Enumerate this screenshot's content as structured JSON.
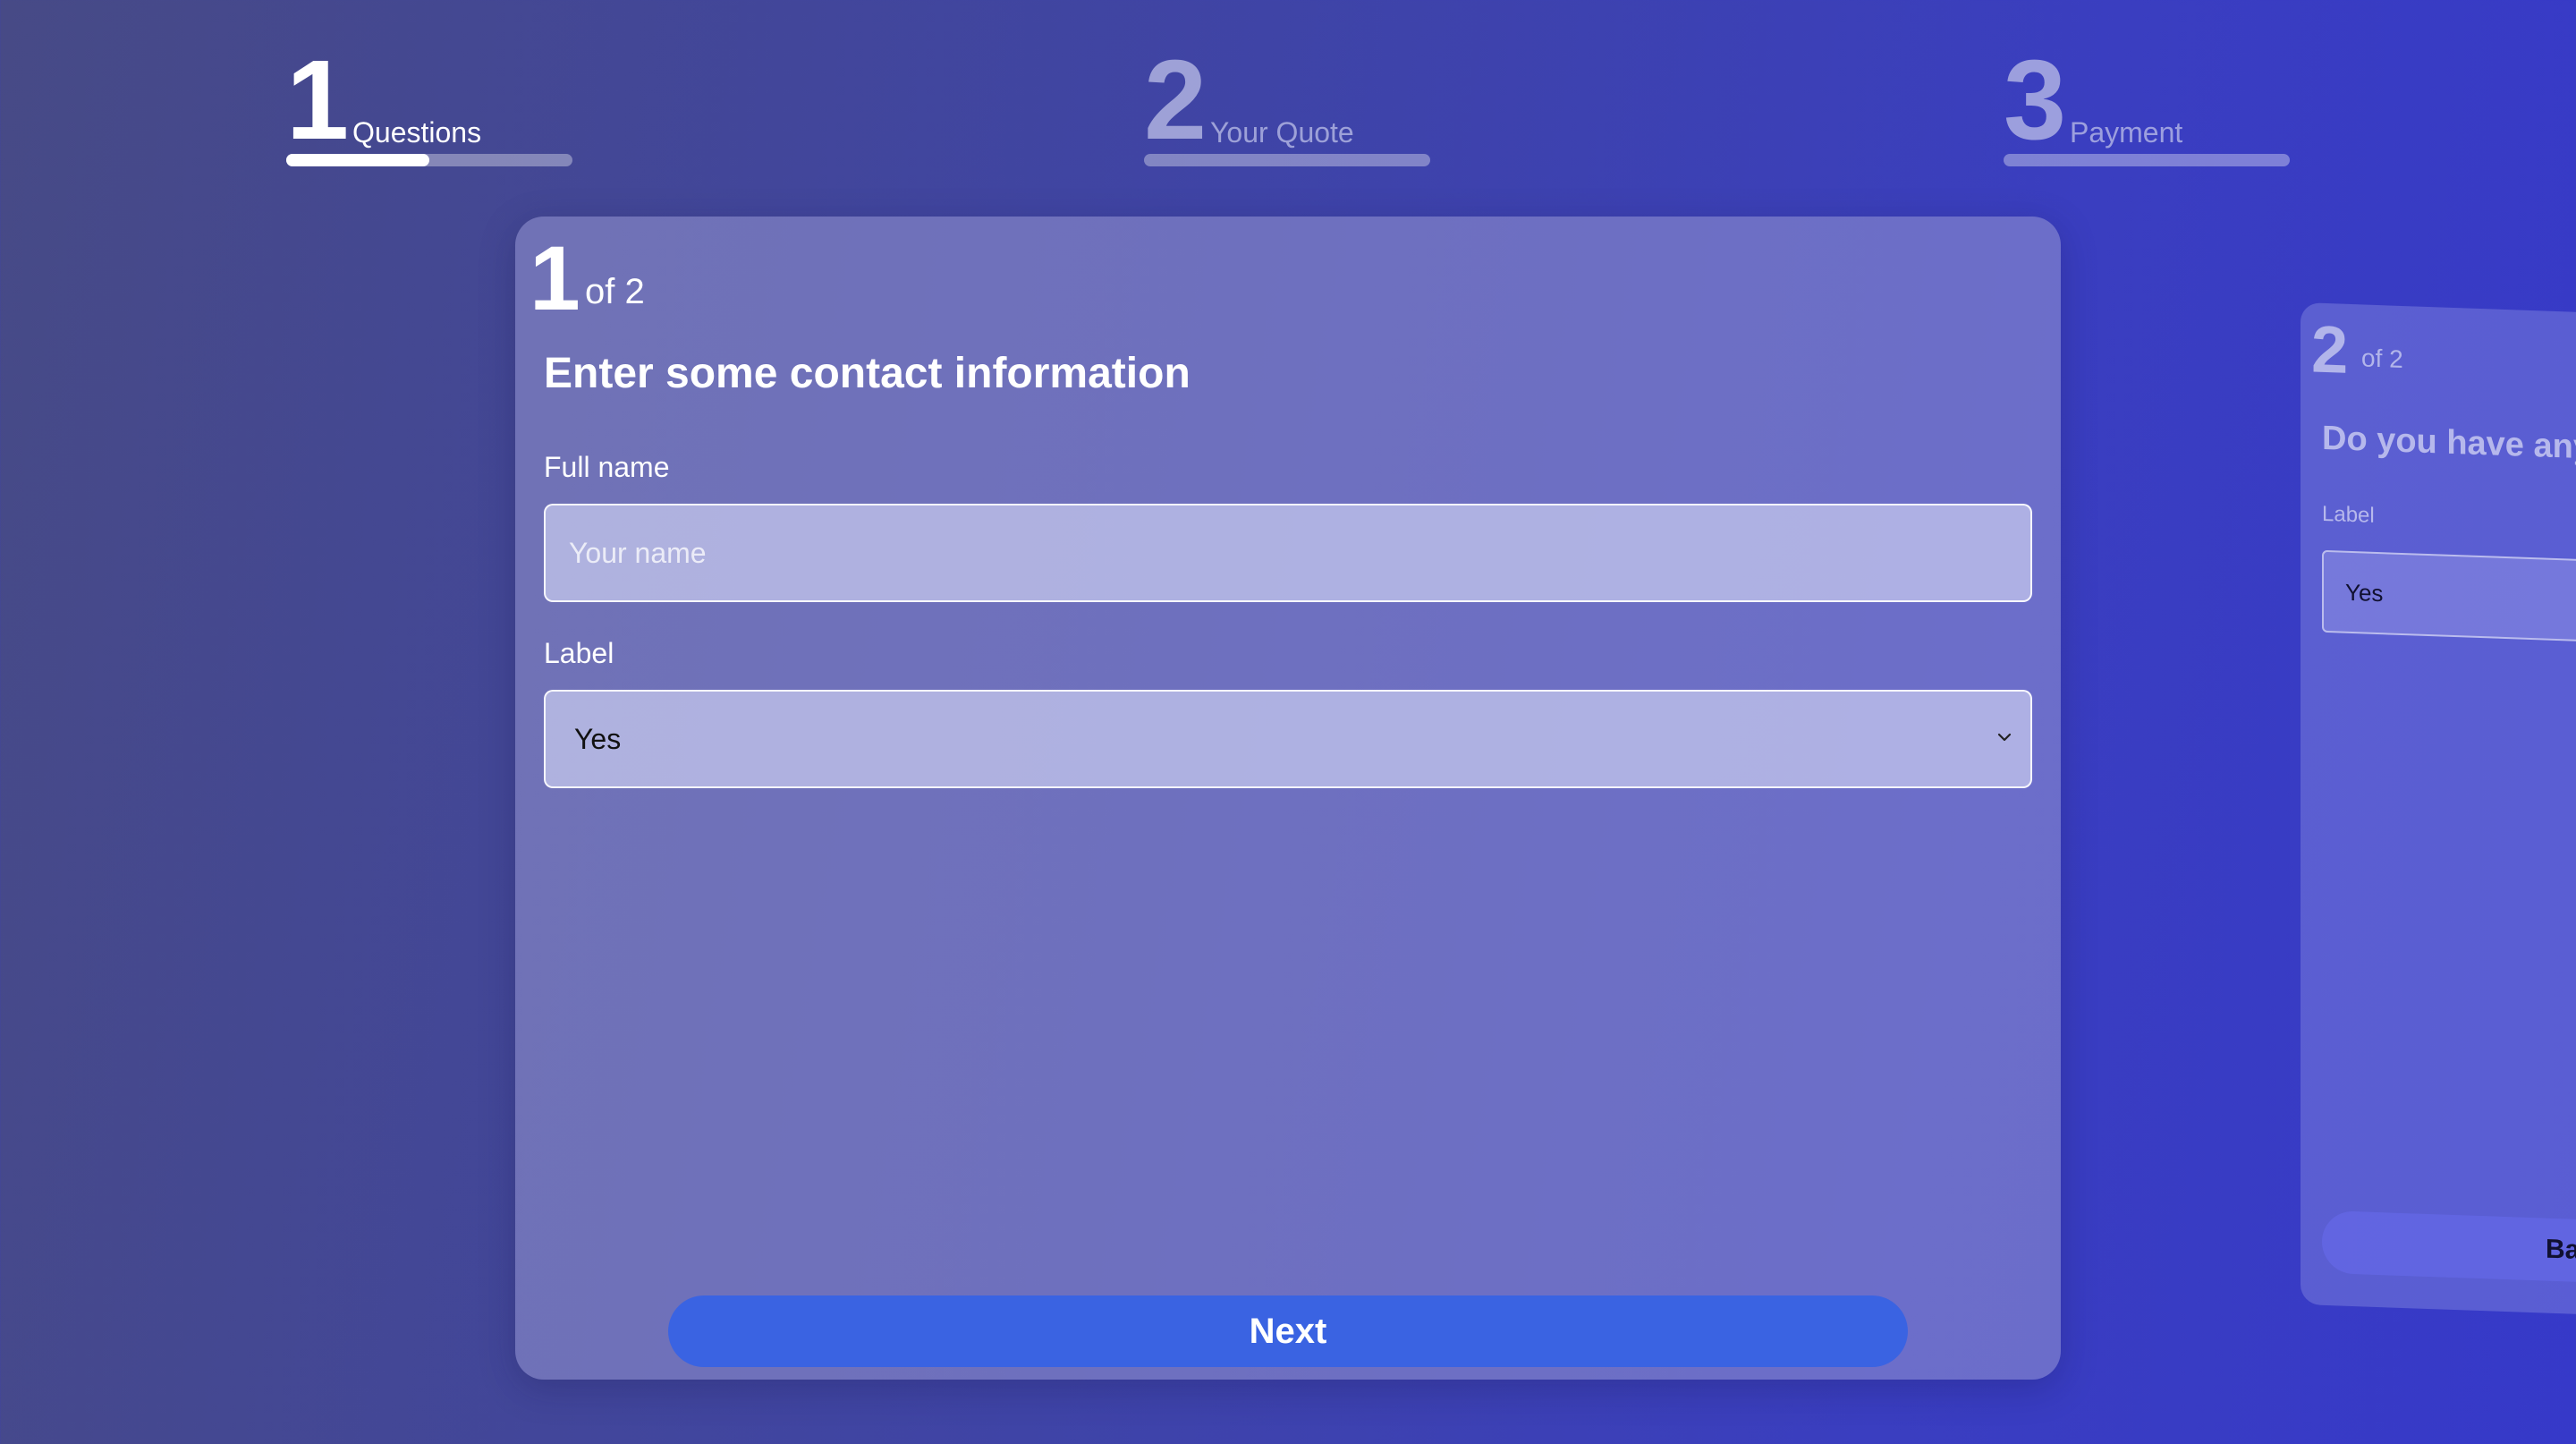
{
  "steps": [
    {
      "number": "1",
      "label": "Questions",
      "state": "active",
      "progress": 0.5
    },
    {
      "number": "2",
      "label": "Your Quote",
      "state": "inactive",
      "progress": 0
    },
    {
      "number": "3",
      "label": "Payment",
      "state": "inactive",
      "progress": 0
    }
  ],
  "current_question": {
    "number": "1",
    "of_label": "of 2",
    "title": "Enter some contact information",
    "full_name": {
      "label": "Full name",
      "placeholder": "Your name",
      "value": ""
    },
    "select": {
      "label": "Label",
      "value": "Yes"
    },
    "next_label": "Next"
  },
  "next_question": {
    "number": "2",
    "of_label": "of 2",
    "title_visible": "Do you have any di",
    "select_label": "Label",
    "select_value": "Yes",
    "back_label_visible": "Ba"
  },
  "colors": {
    "primary_button": "#3a63e2",
    "progress_fill": "#ffffff",
    "background_start": "#474a86",
    "background_end": "#3639c9"
  },
  "icons": {
    "select_chevron": "chevron-down-icon"
  }
}
